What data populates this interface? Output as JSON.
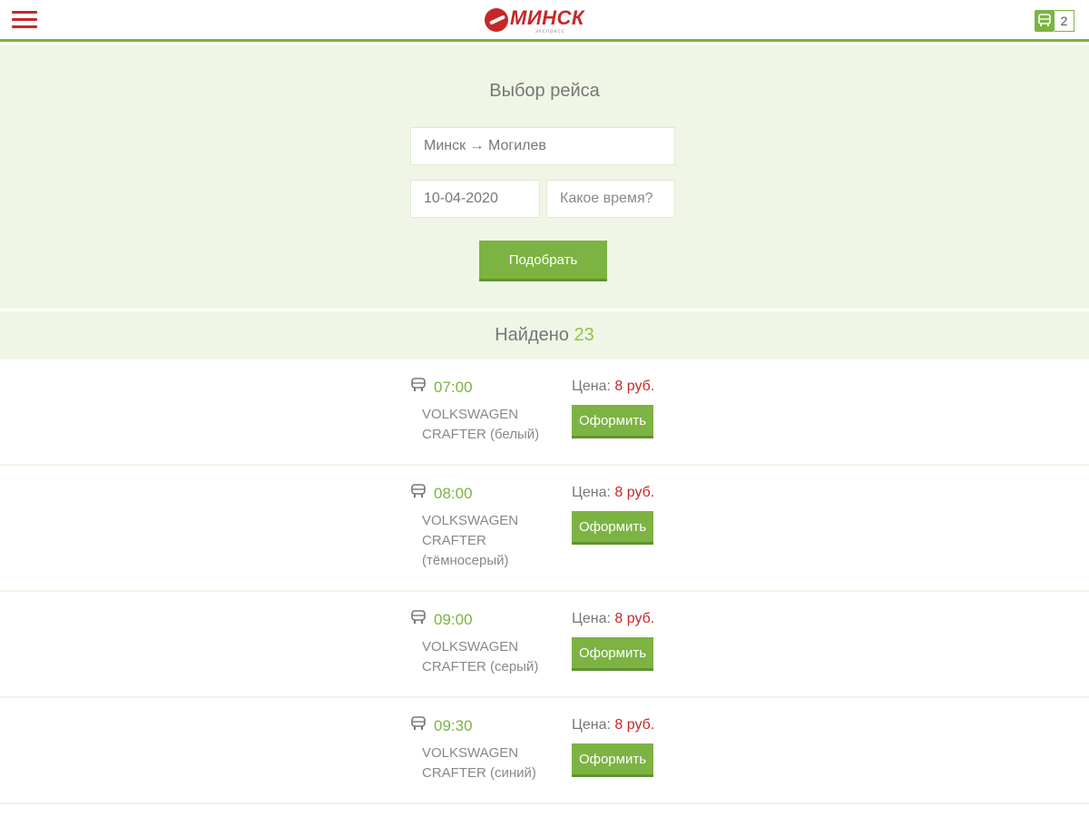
{
  "header": {
    "logo_text": "МИНСК",
    "logo_sub": "экспресс",
    "cart_count": "2"
  },
  "search": {
    "title": "Выбор рейса",
    "route_value": "Минск → Могилев",
    "date_value": "10-04-2020",
    "time_placeholder": "Какое время?",
    "submit_label": "Подобрать"
  },
  "results": {
    "found_label": "Найдено",
    "found_count": "23",
    "price_label": "Цена:",
    "order_label": "Оформить",
    "trips": [
      {
        "time": "07:00",
        "vehicle": "VOLKSWAGEN CRAFTER (белый)",
        "price": "8 руб."
      },
      {
        "time": "08:00",
        "vehicle": "VOLKSWAGEN CRAFTER (тёмносерый)",
        "price": "8 руб."
      },
      {
        "time": "09:00",
        "vehicle": "VOLKSWAGEN CRAFTER (серый)",
        "price": "8 руб."
      },
      {
        "time": "09:30",
        "vehicle": "VOLKSWAGEN CRAFTER (синий)",
        "price": "8 руб."
      }
    ]
  },
  "colors": {
    "accent_green": "#7cb342",
    "brand_red": "#c62828",
    "panel_bg": "#f0f6e6"
  }
}
